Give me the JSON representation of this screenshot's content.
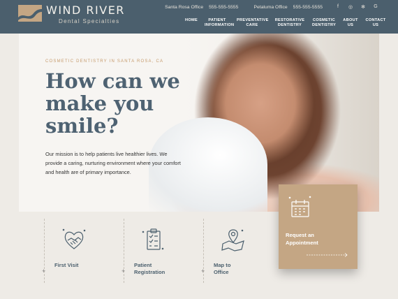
{
  "brand": {
    "name": "WIND RIVER",
    "tagline": "Dental Specialties",
    "accent": "#c4a684",
    "header_bg": "#4b5f6d"
  },
  "topbar": {
    "office1_name": "Santa Rosa Office",
    "office1_phone": "555-555-5555",
    "office2_name": "Petaluma Office",
    "office2_phone": "555-555-5555",
    "social": [
      {
        "icon": "facebook-icon",
        "glyph": "f"
      },
      {
        "icon": "instagram-icon",
        "glyph": "◎"
      },
      {
        "icon": "yelp-icon",
        "glyph": "✻"
      },
      {
        "icon": "google-icon",
        "glyph": "G"
      }
    ]
  },
  "nav": [
    {
      "label": "HOME"
    },
    {
      "label": "PATIENT INFORMATION"
    },
    {
      "label": "PREVENTATIVE CARE"
    },
    {
      "label": "RESTORATIVE DENTISTRY"
    },
    {
      "label": "COSMETIC DENTISTRY"
    },
    {
      "label": "ABOUT US"
    },
    {
      "label": "CONTACT US"
    }
  ],
  "hero": {
    "eyebrow": "COSMETIC DENTISTRY IN SANTA ROSA, CA",
    "headline": "How can we make you smile?",
    "mission": "Our mission is to help patients live healthier lives. We provide a caring, nurturing environment where your comfort and health are of primary importance."
  },
  "cards": [
    {
      "label": "First Visit",
      "icon": "handshake-heart-icon"
    },
    {
      "label": "Patient Registration",
      "icon": "clipboard-checklist-icon"
    },
    {
      "label": "Map to Office",
      "icon": "map-pin-icon"
    }
  ],
  "appointment": {
    "label": "Request an Appointment",
    "icon": "calendar-icon"
  }
}
